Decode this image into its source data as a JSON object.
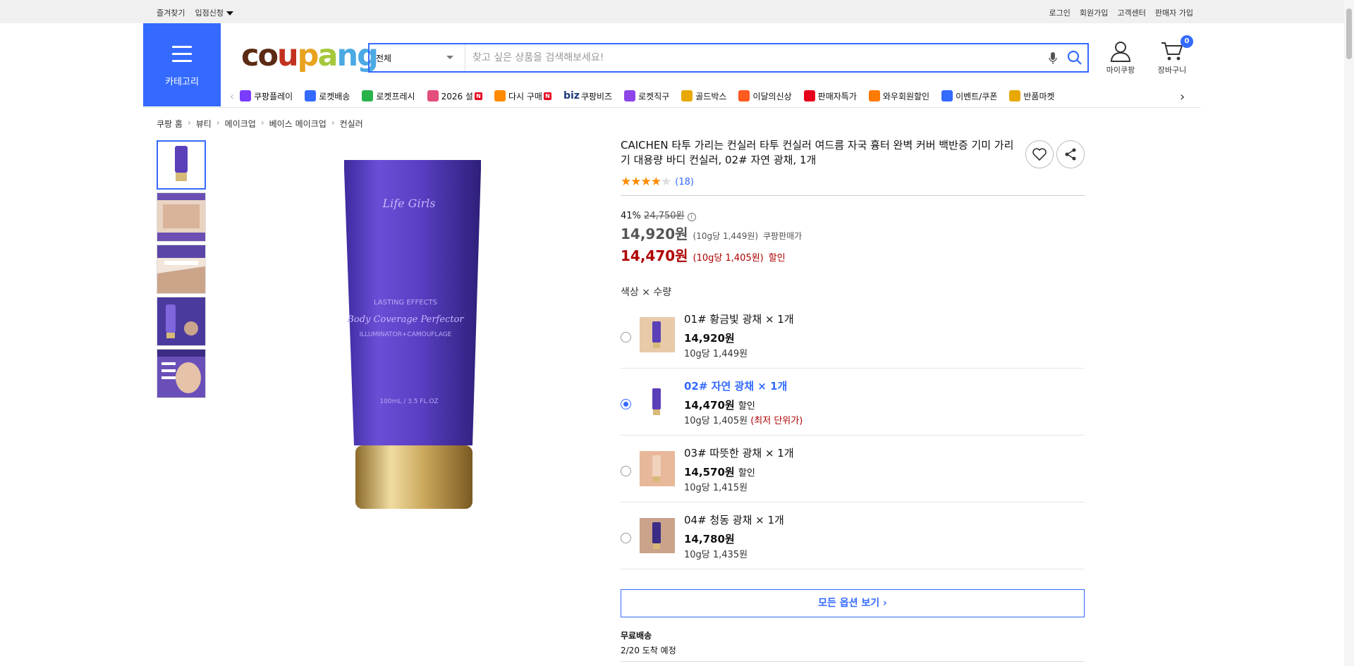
{
  "topbar": {
    "left": [
      "즐겨찾기",
      "입점신청"
    ],
    "right": [
      "로그인",
      "회원가입",
      "고객센터",
      "판매자 가입"
    ]
  },
  "header": {
    "category_label": "카테고리",
    "logo": "coupang",
    "search_category": "전체",
    "search_placeholder": "찾고 싶은 상품을 검색해보세요!",
    "mycoupang": "마이쿠팡",
    "cart": "장바구니",
    "cart_count": "0"
  },
  "nav": [
    {
      "label": "쿠팡플레이",
      "color": "#7a3cff"
    },
    {
      "label": "로켓배송",
      "color": "#346aff"
    },
    {
      "label": "로켓프레시",
      "color": "#2ab24a"
    },
    {
      "label": "2026 설",
      "color": "#e34e7b",
      "new": "N"
    },
    {
      "label": "다시 구매",
      "color": "#ff8a00",
      "new": "N"
    },
    {
      "label": "쿠팡비즈",
      "prefix": "biz",
      "color": "#1c3a7a"
    },
    {
      "label": "로켓직구",
      "color": "#8d45e8"
    },
    {
      "label": "골드박스",
      "color": "#e8a800"
    },
    {
      "label": "이달의신상",
      "color": "#ff5a1f"
    },
    {
      "label": "판매자특가",
      "color": "#e6001c"
    },
    {
      "label": "와우회원할인",
      "color": "#ff7a00"
    },
    {
      "label": "이벤트/쿠폰",
      "color": "#346aff"
    },
    {
      "label": "반품마켓",
      "color": "#e8a800"
    }
  ],
  "breadcrumb": [
    "쿠팡 홈",
    "뷰티",
    "메이크업",
    "베이스 메이크업",
    "컨실러"
  ],
  "product": {
    "title": "CAICHEN 타투 가리는 컨실러 타투 컨실러 여드름 자국 흉터 완벽 커버 백반증 기미 가리기 대용량 바디 컨실러, 02# 자연 광채, 1개",
    "rating": 4,
    "review_count": "(18)",
    "discount_rate": "41%",
    "original_price": "24,750원",
    "coupang_price": "14,920원",
    "coupang_unit": "(10g당 1,449원)",
    "coupang_label": "쿠팡판매가",
    "sale_price": "14,470원",
    "sale_unit": "(10g당 1,405원)",
    "sale_label": "할인",
    "tube_text_brand": "Life Girls",
    "tube_text_1": "LASTING EFFECTS",
    "tube_text_2": "Body Coverage Perfector",
    "tube_text_3": "ILLUMINATOR+CAMOUFLAGE",
    "tube_text_4": "100mL / 3.5 FL.OZ"
  },
  "options": {
    "label": "색상 × 수량",
    "items": [
      {
        "name": "01# 황금빛 광채 × 1개",
        "price": "14,920원",
        "tag": "",
        "unit": "10g당 1,449원",
        "note": ""
      },
      {
        "name": "02# 자연 광채 × 1개",
        "price": "14,470원",
        "tag": "할인",
        "unit": "10g당 1,405원",
        "note": "(최저 단위가)"
      },
      {
        "name": "03# 따뜻한 광채 × 1개",
        "price": "14,570원",
        "tag": "할인",
        "unit": "10g당 1,415원",
        "note": ""
      },
      {
        "name": "04# 청동 광채 × 1개",
        "price": "14,780원",
        "tag": "",
        "unit": "10g당 1,435원",
        "note": ""
      }
    ],
    "all_button": "모든 옵션 보기"
  },
  "shipping": {
    "title": "무료배송",
    "eta": "2/20 도착 예정"
  }
}
